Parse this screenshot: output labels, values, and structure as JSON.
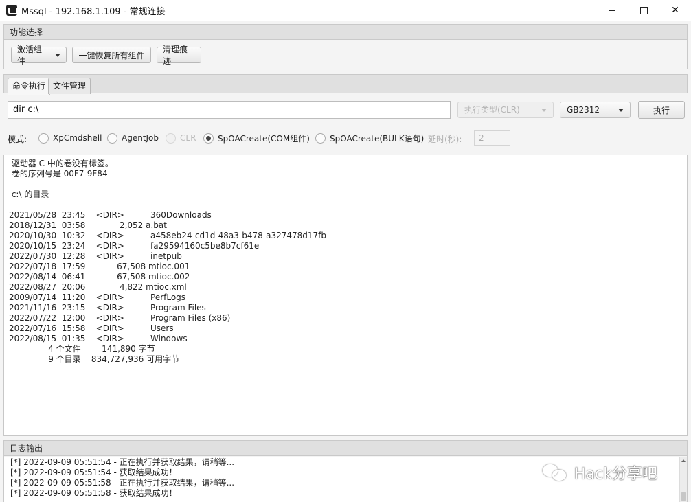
{
  "window": {
    "title": "Mssql - 192.168.1.109 - 常规连接",
    "close_glyph": "✕"
  },
  "function_panel": {
    "header": "功能选择",
    "activate_label": "激活组件",
    "restore_label": "一键恢复所有组件",
    "clean_label": "清理痕迹"
  },
  "tabs": [
    {
      "label": "命令执行",
      "active": true
    },
    {
      "label": "文件管理",
      "active": false
    }
  ],
  "command": {
    "value": "dir c:\\",
    "exec_type_placeholder": "执行类型(CLR)",
    "encoding": "GB2312",
    "execute_label": "执行"
  },
  "mode": {
    "label": "模式:",
    "options": [
      {
        "label": "XpCmdshell",
        "checked": false,
        "disabled": false
      },
      {
        "label": "AgentJob",
        "checked": false,
        "disabled": false
      },
      {
        "label": "CLR",
        "checked": false,
        "disabled": true
      },
      {
        "label": "SpOACreate(COM组件)",
        "checked": true,
        "disabled": false
      },
      {
        "label": "SpOACreate(BULK语句)",
        "checked": false,
        "disabled": false
      }
    ],
    "delay_label": "延时(秒):",
    "delay_value": "2"
  },
  "output_lines": [
    " 驱动器 C 中的卷没有标签。",
    " 卷的序列号是 00F7-9F84",
    "",
    " c:\\ 的目录",
    "",
    "2021/05/28  23:45    <DIR>          360Downloads",
    "2018/12/31  03:58             2,052 a.bat",
    "2020/10/30  10:32    <DIR>          a458eb24-cd1d-48a3-b478-a327478d17fb",
    "2020/10/15  23:24    <DIR>          fa29594160c5be8b7cf61e",
    "2022/07/30  12:28    <DIR>          inetpub",
    "2022/07/18  17:59            67,508 mtioc.001",
    "2022/08/14  06:41            67,508 mtioc.002",
    "2022/08/27  20:06             4,822 mtioc.xml",
    "2009/07/14  11:20    <DIR>          PerfLogs",
    "2021/11/16  23:15    <DIR>          Program Files",
    "2022/07/22  12:00    <DIR>          Program Files (x86)",
    "2022/07/16  15:58    <DIR>          Users",
    "2022/08/15  01:35    <DIR>          Windows",
    "               4 个文件        141,890 字节",
    "               9 个目录    834,727,936 可用字节"
  ],
  "log": {
    "header": "日志输出",
    "lines": [
      "[*] 2022-09-09 05:51:54 - 正在执行并获取结果，请稍等...",
      "[*] 2022-09-09 05:51:54 - 获取结果成功！",
      "[*] 2022-09-09 05:51:58 - 正在执行并获取结果，请稍等...",
      "[*] 2022-09-09 05:51:58 - 获取结果成功！"
    ]
  },
  "watermark": {
    "text": "Hack分享吧",
    "icon": "wechat-icon"
  }
}
